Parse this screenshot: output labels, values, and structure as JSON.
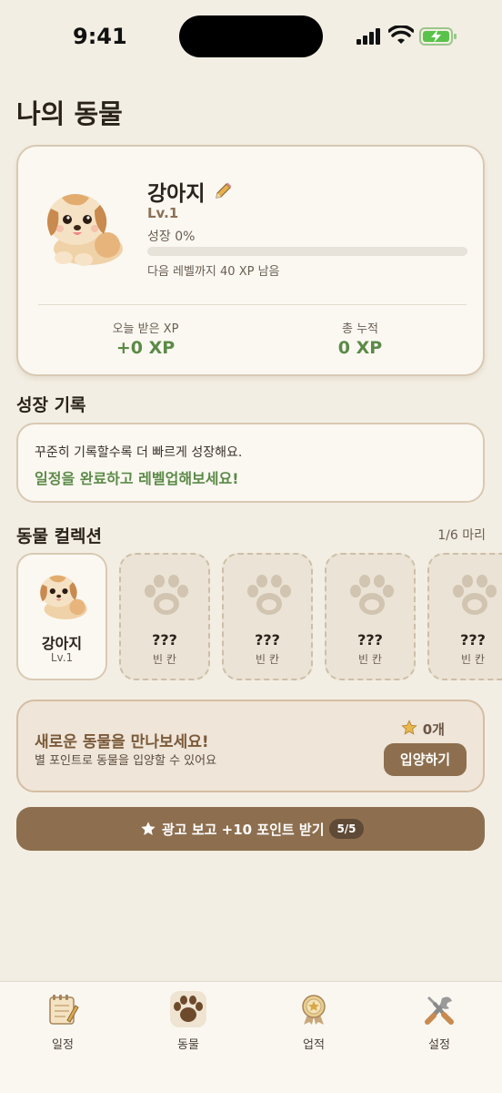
{
  "status_bar": {
    "time": "9:41"
  },
  "page": {
    "title": "나의 동물"
  },
  "pet": {
    "name": "강아지",
    "level": "Lv.1",
    "growth_label": "성장 0%",
    "growth_progress_percent": 0,
    "next_level_text": "다음 레벨까지 40 XP 남음",
    "today_xp_label": "오늘 받은 XP",
    "today_xp_value": "+0 XP",
    "total_xp_label": "총 누적",
    "total_xp_value": "0 XP"
  },
  "growth_record": {
    "title": "성장 기록",
    "text": "꾸준히 기록할수록 더 빠르게 성장해요.",
    "cta": "일정을 완료하고 레벨업해보세요!"
  },
  "collection": {
    "title": "동물 컬렉션",
    "count": "1/6 마리",
    "slots": [
      {
        "name": "강아지",
        "sub": "Lv.1",
        "owned": true
      },
      {
        "name": "???",
        "sub": "빈 칸",
        "owned": false
      },
      {
        "name": "???",
        "sub": "빈 칸",
        "owned": false
      },
      {
        "name": "???",
        "sub": "빈 칸",
        "owned": false
      },
      {
        "name": "???",
        "sub": "빈 칸",
        "owned": false
      }
    ]
  },
  "adopt": {
    "title": "새로운 동물을 만나보세요!",
    "subtitle": "별 포인트로 동물을 입양할 수 있어요",
    "star_count": "0개",
    "button": "입양하기"
  },
  "ad": {
    "label": "광고 보고 +10 포인트 받기",
    "count": "5/5"
  },
  "tabs": [
    {
      "label": "일정",
      "icon": "notepad-icon"
    },
    {
      "label": "동물",
      "icon": "paw-icon",
      "active": true
    },
    {
      "label": "업적",
      "icon": "medal-icon"
    },
    {
      "label": "설정",
      "icon": "tools-icon"
    }
  ],
  "colors": {
    "background": "#f3eee3",
    "accent_brown": "#8d6f4f",
    "xp_green": "#5b8a47",
    "card_border": "#d9c9b3"
  }
}
